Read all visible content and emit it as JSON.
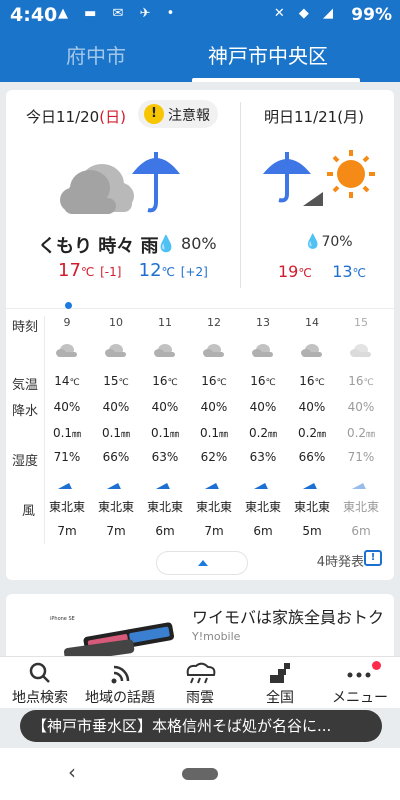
{
  "status_bar": {
    "time": "4:40",
    "battery": "99%"
  },
  "city_tabs": [
    "府中市",
    "神戸市中央区"
  ],
  "today": {
    "date_prefix": "今日11/20",
    "weekday": "(日)",
    "alert": "注意報",
    "weather": "くもり 時々 雨",
    "precip": "80%",
    "high": "17",
    "high_diff": "[-1]",
    "low": "12",
    "low_diff": "[+2]"
  },
  "tomorrow": {
    "date": "明日11/21(月)",
    "precip": "70%",
    "high": "19",
    "low": "13"
  },
  "temp_unit": "℃",
  "row_labels": [
    "時刻",
    "気温",
    "降水",
    "湿度",
    "風"
  ],
  "hours": [
    {
      "hour": "9",
      "temp": "14",
      "precip": "40%",
      "rain": "0.1",
      "humidity": "71%",
      "wind_dir": "東北東",
      "wind_speed": "7m"
    },
    {
      "hour": "10",
      "temp": "15",
      "precip": "40%",
      "rain": "0.1",
      "humidity": "66%",
      "wind_dir": "東北東",
      "wind_speed": "7m"
    },
    {
      "hour": "11",
      "temp": "16",
      "precip": "40%",
      "rain": "0.1",
      "humidity": "63%",
      "wind_dir": "東北東",
      "wind_speed": "6m"
    },
    {
      "hour": "12",
      "temp": "16",
      "precip": "40%",
      "rain": "0.1",
      "humidity": "62%",
      "wind_dir": "東北東",
      "wind_speed": "7m"
    },
    {
      "hour": "13",
      "temp": "16",
      "precip": "40%",
      "rain": "0.2",
      "humidity": "63%",
      "wind_dir": "東北東",
      "wind_speed": "6m"
    },
    {
      "hour": "14",
      "temp": "16",
      "precip": "40%",
      "rain": "0.2",
      "humidity": "66%",
      "wind_dir": "東北東",
      "wind_speed": "5m"
    },
    {
      "hour": "15",
      "temp": "16",
      "precip": "40%",
      "rain": "0.2",
      "humidity": "71%",
      "wind_dir": "東北東",
      "wind_speed": "6m"
    }
  ],
  "rain_unit": "㎜",
  "issued": "4時発表",
  "ad": {
    "title": "ワイモバは家族全員おトク",
    "sponsor": "Y!mobile",
    "image_text": "iPhone SE"
  },
  "bottom_nav": [
    "地点検索",
    "地域の話題",
    "雨雲",
    "全国",
    "メニュー"
  ],
  "toast": "【神戸市垂水区】本格信州そば処が名谷に...",
  "colors": {
    "brand_blue": "#1a74c9",
    "high_red": "#d21c2c",
    "low_blue": "#1d6fd1",
    "alert_yellow": "#f7c600"
  },
  "icons": {
    "today": "cloud-with-umbrella",
    "tomorrow": "umbrella-then-sun",
    "hourly": "cloud",
    "nav": [
      "search-icon",
      "topics-icon",
      "rain-cloud-icon",
      "map-icon",
      "menu-icon"
    ]
  }
}
